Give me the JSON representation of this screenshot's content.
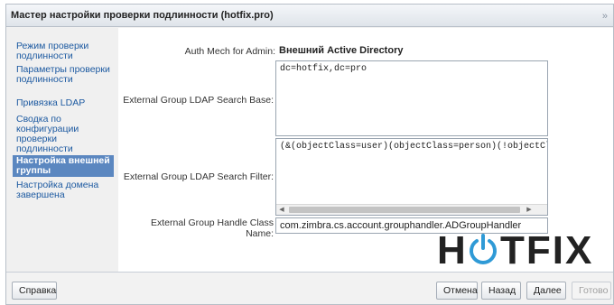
{
  "window": {
    "title": "Мастер настройки проверки подлинности (hotfix.pro)",
    "expand_glyph": "»"
  },
  "nav": {
    "items": [
      "Режим проверки подлинности",
      "Параметры проверки подлинности",
      "Привязка LDAP",
      "Сводка по конфигурации проверки подлинности",
      "Настройка внешней группы",
      "Настройка домена завершена"
    ],
    "active_index": 4
  },
  "form": {
    "auth_mech_label": "Auth Mech for Admin:",
    "auth_mech_value": "Внешний Active Directory",
    "search_base_label": "External Group LDAP Search Base:",
    "search_base_value": "dc=hotfix,dc=pro",
    "search_filter_label": "External Group LDAP Search Filter:",
    "search_filter_value": "(&(objectClass=user)(objectClass=person)(!objectClass=comp",
    "handler_label": "External Group Handle Class Name:",
    "handler_value": "com.zimbra.cs.account.grouphandler.ADGroupHandler"
  },
  "footer": {
    "help": "Справка",
    "cancel": "Отмена",
    "back": "Назад",
    "next": "Далее",
    "finish": "Готово"
  },
  "logo": {
    "text_h": "H",
    "text_tfix": "TFIX",
    "color_accent": "#2f9ad6"
  }
}
